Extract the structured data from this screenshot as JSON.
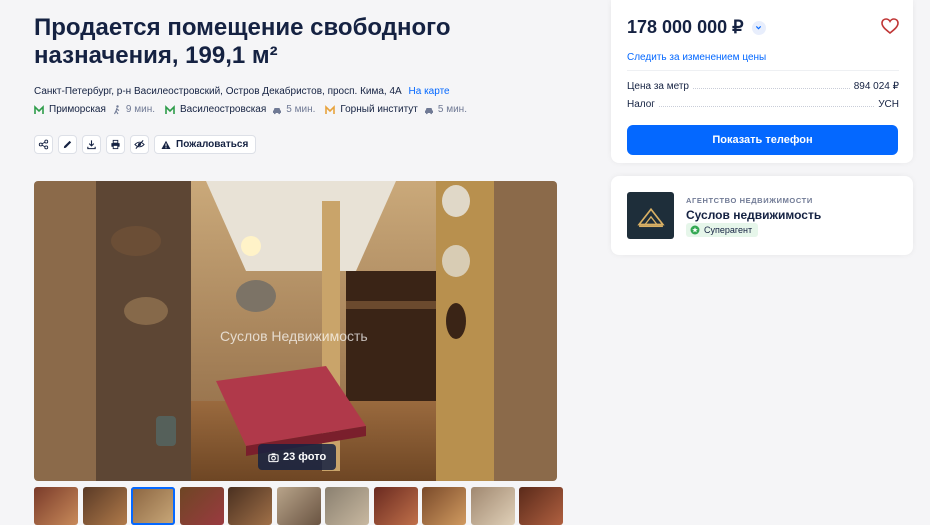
{
  "listing": {
    "title": "Продается помещение свободного назначения, 199,1 м²",
    "address": "Санкт-Петербург, р-н Василеостровский, Остров Декабристов, просп. Кима, 4А",
    "map_link": "На карте",
    "metro": [
      {
        "name": "Приморская",
        "color": "#2e9c4a",
        "transport": "walk",
        "time": "9 мин."
      },
      {
        "name": "Василеостровская",
        "color": "#2e9c4a",
        "transport": "car",
        "time": "5 мин."
      },
      {
        "name": "Горный институт",
        "color": "#e8a33d",
        "transport": "car",
        "time": "5 мин."
      }
    ],
    "toolbar": {
      "complain_label": "Пожаловаться",
      "icons": [
        "share-icon",
        "edit-icon",
        "download-icon",
        "print-icon",
        "hide-icon"
      ]
    }
  },
  "gallery": {
    "watermark": "Суслов Недвижимость",
    "photo_count_label": "23 фото",
    "thumbnails": 11,
    "active_thumbnail": 3
  },
  "price_card": {
    "price": "178 000 000 ₽",
    "follow_price": "Следить за изменением цены",
    "price_per_meter_label": "Цена за метр",
    "price_per_meter_value": "894 024 ₽",
    "tax_label": "Налог",
    "tax_value": "УСН",
    "show_phone": "Показать телефон"
  },
  "agent": {
    "type": "АГЕНТСТВО НЕДВИЖИМОСТИ",
    "name": "Суслов недвижимость",
    "badge": "Суперагент"
  },
  "colors": {
    "accent": "#0468ff",
    "text": "#152242",
    "secondary": "#707a95",
    "heart": "#c03636"
  }
}
